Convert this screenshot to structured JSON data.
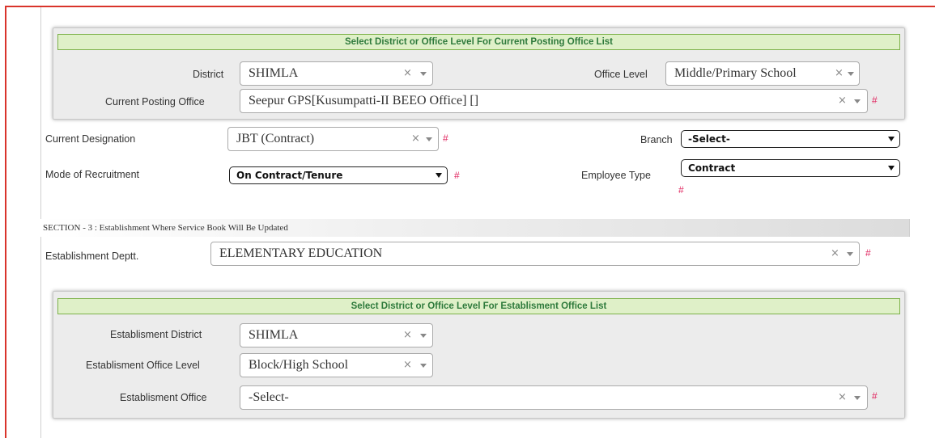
{
  "panel1": {
    "header": "Select District or Office Level For Current Posting Office List",
    "district_label": "District",
    "district_value": "SHIMLA",
    "office_level_label": "Office Level",
    "office_level_value": "Middle/Primary School",
    "current_office_label": "Current Posting Office",
    "current_office_value": "Seepur GPS[Kusumpatti-II BEEO Office] []"
  },
  "form": {
    "designation_label": "Current Designation",
    "designation_value": "JBT (Contract)",
    "branch_label": "Branch",
    "branch_value": "-Select-",
    "recruitment_label": "Mode of Recruitment",
    "recruitment_value": "On Contract/Tenure",
    "employee_type_label": "Employee Type",
    "employee_type_value": "Contract"
  },
  "section3": {
    "title": "SECTION - 3 : Establishment Where Service Book Will Be Updated",
    "dept_label": "Establishment Deptt.",
    "dept_value": "ELEMENTARY EDUCATION"
  },
  "panel2": {
    "header": "Select District or Office Level For Establisment Office List",
    "district_label": "Establisment District",
    "district_value": "SHIMLA",
    "office_level_label": "Establisment Office Level",
    "office_level_value": "Block/High School",
    "office_label": "Establisment Office",
    "office_value": "-Select-"
  },
  "common": {
    "clear_glyph": "×",
    "required_mark": "#"
  },
  "colors": {
    "frame": "#d9342b",
    "header_bg": "#dff0c8",
    "header_border": "#7db24a",
    "header_text": "#2e7a3c",
    "required": "#e0245e"
  }
}
